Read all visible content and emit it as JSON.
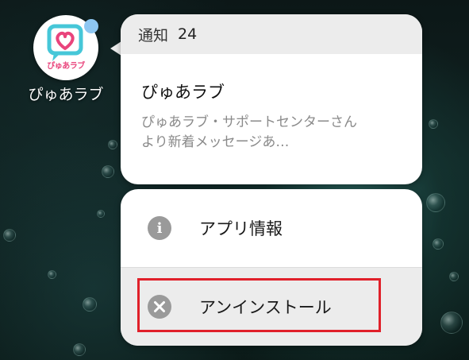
{
  "app": {
    "name": "ぴゅあラブ",
    "icon_logo_text": "ぴゅあラブ",
    "icon": "heart-chat-icon",
    "badge_color": "#8ec7f2",
    "brand_colors": {
      "cyan": "#46c7d8",
      "pink": "#e9447c"
    }
  },
  "notification": {
    "header_label": "通知",
    "count": "24",
    "title": "ぴゅあラブ",
    "message": "ぴゅあラブ・サポートセンターさんより新着メッセージあ…"
  },
  "menu": {
    "items": [
      {
        "label": "アプリ情報",
        "icon": "info-icon"
      },
      {
        "label": "アンインストール",
        "icon": "close-circle-icon"
      }
    ]
  },
  "highlight": {
    "color": "#e0202a",
    "target": "アンインストール"
  }
}
